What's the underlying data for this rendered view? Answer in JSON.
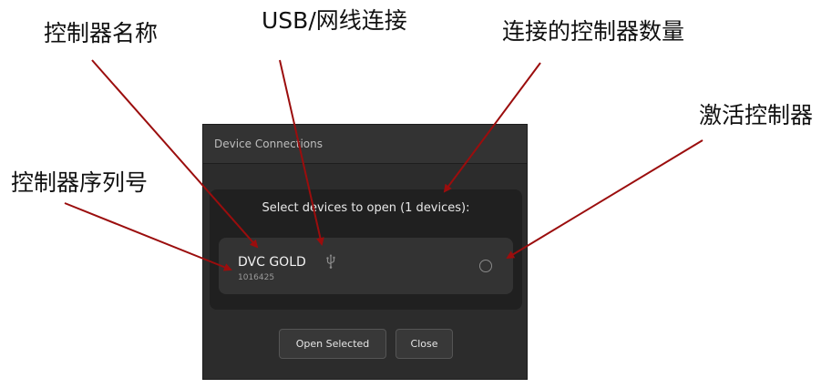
{
  "callouts": {
    "controller_name": "控制器名称",
    "usb_network": "USB/网线连接",
    "device_count": "连接的控制器数量",
    "controller_serial": "控制器序列号",
    "activate_controller": "激活控制器"
  },
  "dialog": {
    "title": "Device Connections",
    "heading": "Select devices to open (1 devices):",
    "devices": [
      {
        "name": "DVC GOLD",
        "serial": "1016425",
        "connection_icon": "usb-icon",
        "selected": false
      }
    ],
    "buttons": {
      "open_selected": "Open Selected",
      "close": "Close"
    }
  },
  "colors": {
    "arrow": "#9b0d0d",
    "dialog_bg": "#2c2c2c",
    "panel_bg": "#202020",
    "row_bg": "#333333"
  }
}
